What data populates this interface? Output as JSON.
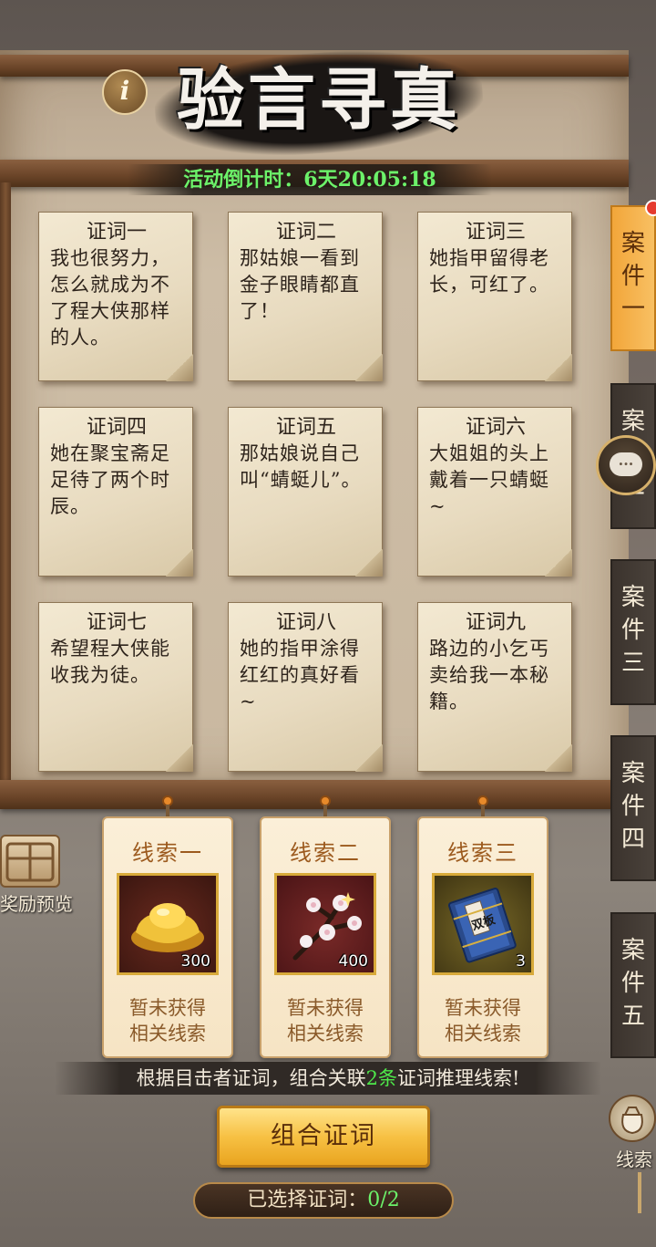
{
  "header": {
    "title": "验言寻真",
    "info_icon": "i",
    "countdown_label": "活动倒计时：",
    "countdown_value": "6天20:05:18"
  },
  "testimonies": [
    {
      "caption": "证词一",
      "text": "我也很努力，怎么就成为不了程大侠那样的人。"
    },
    {
      "caption": "证词二",
      "text": "那姑娘一看到金子眼睛都直了！"
    },
    {
      "caption": "证词三",
      "text": "她指甲留得老长，可红了。"
    },
    {
      "caption": "证词四",
      "text": "她在聚宝斋足足待了两个时辰。"
    },
    {
      "caption": "证词五",
      "text": "那姑娘说自己叫“蜻蜓儿”。"
    },
    {
      "caption": "证词六",
      "text": "大姐姐的头上戴着一只蜻蜓~"
    },
    {
      "caption": "证词七",
      "text": "希望程大侠能收我为徒。"
    },
    {
      "caption": "证词八",
      "text": "她的指甲涂得红红的真好看~"
    },
    {
      "caption": "证词九",
      "text": "路边的小乞丐卖给我一本秘籍。"
    }
  ],
  "case_tabs": [
    {
      "label": "案件一",
      "active": true
    },
    {
      "label": "案件二",
      "active": false
    },
    {
      "label": "案件三",
      "active": false
    },
    {
      "label": "案件四",
      "active": false
    },
    {
      "label": "案件五",
      "active": false
    }
  ],
  "chat_icon": "...",
  "clues": [
    {
      "name": "线索一",
      "item": "gold-ingot-icon",
      "count": "300",
      "status_line1": "暂未获得",
      "status_line2": "相关线索"
    },
    {
      "name": "线索二",
      "item": "plum-blossom-icon",
      "count": "400",
      "status_line1": "暂未获得",
      "status_line2": "相关线索"
    },
    {
      "name": "线索三",
      "item": "secret-book-icon",
      "count": "3",
      "status_line1": "暂未获得",
      "status_line2": "相关线索"
    }
  ],
  "book_label": "双板",
  "hint": {
    "prefix": "根据目击者证词，组合关联",
    "highlight": "2条",
    "suffix": "证词推理线索!"
  },
  "combine_button": "组合证词",
  "selected": {
    "label": "已选择证词：",
    "value": "0/2"
  },
  "reward_preview_label": "奖励预览",
  "clue_bag_label": "线索",
  "colors": {
    "accent_green": "#6cf26a",
    "active_tab": "#f8c063",
    "button_gold": "#f7c144"
  }
}
